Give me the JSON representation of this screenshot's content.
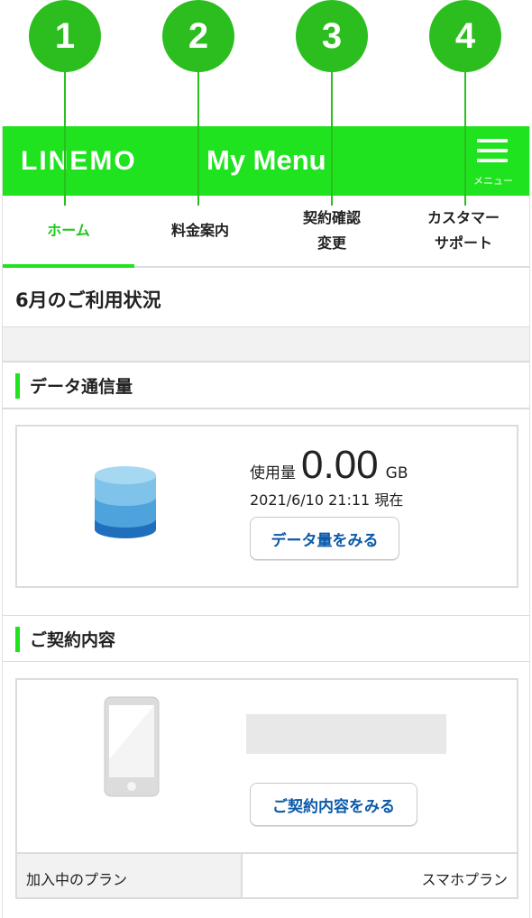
{
  "callouts": [
    "1",
    "2",
    "3",
    "4"
  ],
  "header": {
    "logo": "LINEMO",
    "title": "My Menu",
    "menu_label": "メニュー"
  },
  "tabs": [
    {
      "line1": "ホーム",
      "line2": ""
    },
    {
      "line1": "料金案内",
      "line2": ""
    },
    {
      "line1": "契約確認",
      "line2": "変更"
    },
    {
      "line1": "カスタマー",
      "line2": "サポート"
    }
  ],
  "section_title": "6月のご利用状況",
  "data_section": {
    "heading": "データ通信量",
    "usage_label": "使用量",
    "usage_value": "0.00",
    "usage_unit": "GB",
    "timestamp": "2021/6/10 21:11 現在",
    "button": "データ量をみる",
    "icon": "database-icon"
  },
  "contract_section": {
    "heading": "ご契約内容",
    "button": "ご契約内容をみる",
    "icon": "smartphone-icon",
    "plan_label": "加入中のプラン",
    "plan_value": "スマホプラン"
  },
  "colors": {
    "brand": "#1ee31e",
    "callout": "#2bbe1e",
    "link": "#0a5aa8"
  }
}
